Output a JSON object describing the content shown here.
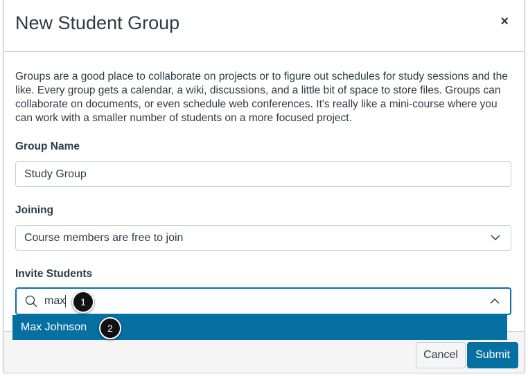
{
  "dialog": {
    "title": "New Student Group",
    "close_label": "×"
  },
  "description": "Groups are a good place to collaborate on projects or to figure out schedules for study sessions and the like. Every group gets a calendar, a wiki, discussions, and a little bit of space to store files. Groups can collaborate on documents, or even schedule web conferences. It's really like a mini-course where you can work with a smaller number of students on a more focused project.",
  "group_name": {
    "label": "Group Name",
    "value": "Study Group"
  },
  "joining": {
    "label": "Joining",
    "value": "Course members are free to join"
  },
  "invite": {
    "label": "Invite Students",
    "value": "max",
    "suggestion": "Max Johnson"
  },
  "callouts": [
    "1",
    "2"
  ],
  "footer": {
    "cancel": "Cancel",
    "submit": "Submit"
  }
}
